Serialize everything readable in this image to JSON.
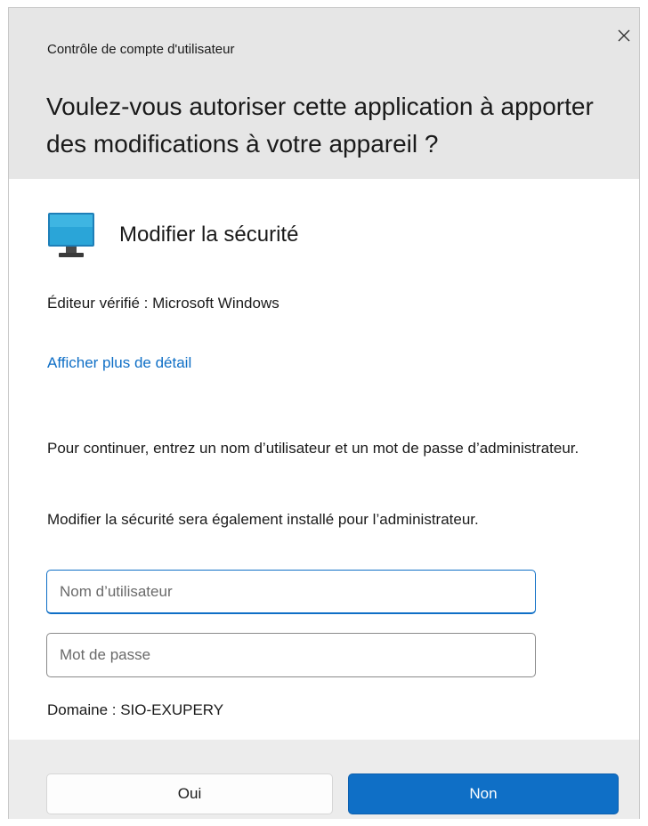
{
  "window": {
    "title": "Contrôle de compte d'utilisateur",
    "close_icon": "close-icon"
  },
  "prompt": {
    "headline": "Voulez-vous autoriser cette application à apporter des modifications à votre appareil ?"
  },
  "app": {
    "icon": "monitor-icon",
    "name": "Modifier la sécurité",
    "publisher": "Éditeur vérifié : Microsoft Windows",
    "details_link": "Afficher plus de détail"
  },
  "credentials": {
    "instructions": "Pour continuer, entrez un nom d’utilisateur et un mot de passe d’administrateur.",
    "install_note": "Modifier la sécurité sera également installé pour l’administrateur.",
    "username_placeholder": "Nom d’utilisateur",
    "username_value": "",
    "password_placeholder": "Mot de passe",
    "password_value": "",
    "domain": "Domaine : SIO-EXUPERY"
  },
  "buttons": {
    "yes_label": "Oui",
    "no_label": "Non"
  },
  "colors": {
    "header_bg": "#e6e6e6",
    "footer_bg": "#ececec",
    "accent": "#0f6fc6",
    "monitor_screen": "#2aa5d8"
  }
}
